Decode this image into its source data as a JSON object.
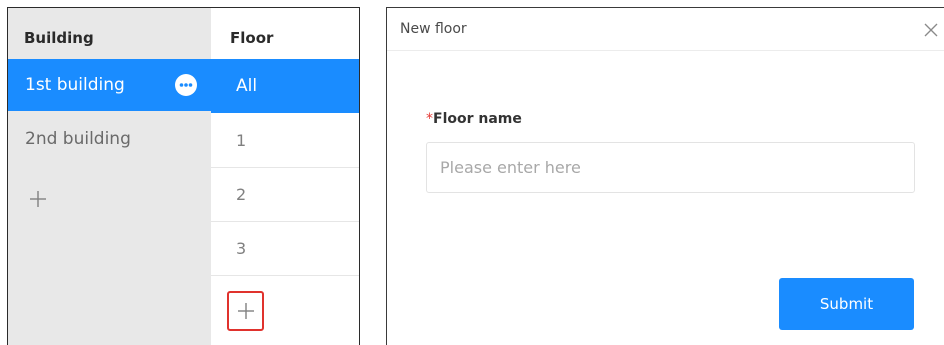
{
  "left_panel": {
    "building_header": "Building",
    "floor_header": "Floor",
    "buildings": [
      {
        "label": "1st building",
        "active": true
      },
      {
        "label": "2nd building",
        "active": false
      }
    ],
    "floors": [
      {
        "label": "All",
        "active": true
      },
      {
        "label": "1",
        "active": false
      },
      {
        "label": "2",
        "active": false
      },
      {
        "label": "3",
        "active": false
      }
    ],
    "icons": {
      "more": "ellipsis-circle-icon",
      "add_building": "plus-icon",
      "add_floor": "plus-icon"
    }
  },
  "dialog": {
    "title": "New floor",
    "close_icon": "close-icon",
    "field": {
      "required_mark": "*",
      "label": "Floor name",
      "value": "",
      "placeholder": "Please enter here"
    },
    "submit_label": "Submit"
  },
  "colors": {
    "accent": "#1a8cff",
    "highlight_border": "#e0322d",
    "building_column_bg": "#e8e8e8"
  }
}
